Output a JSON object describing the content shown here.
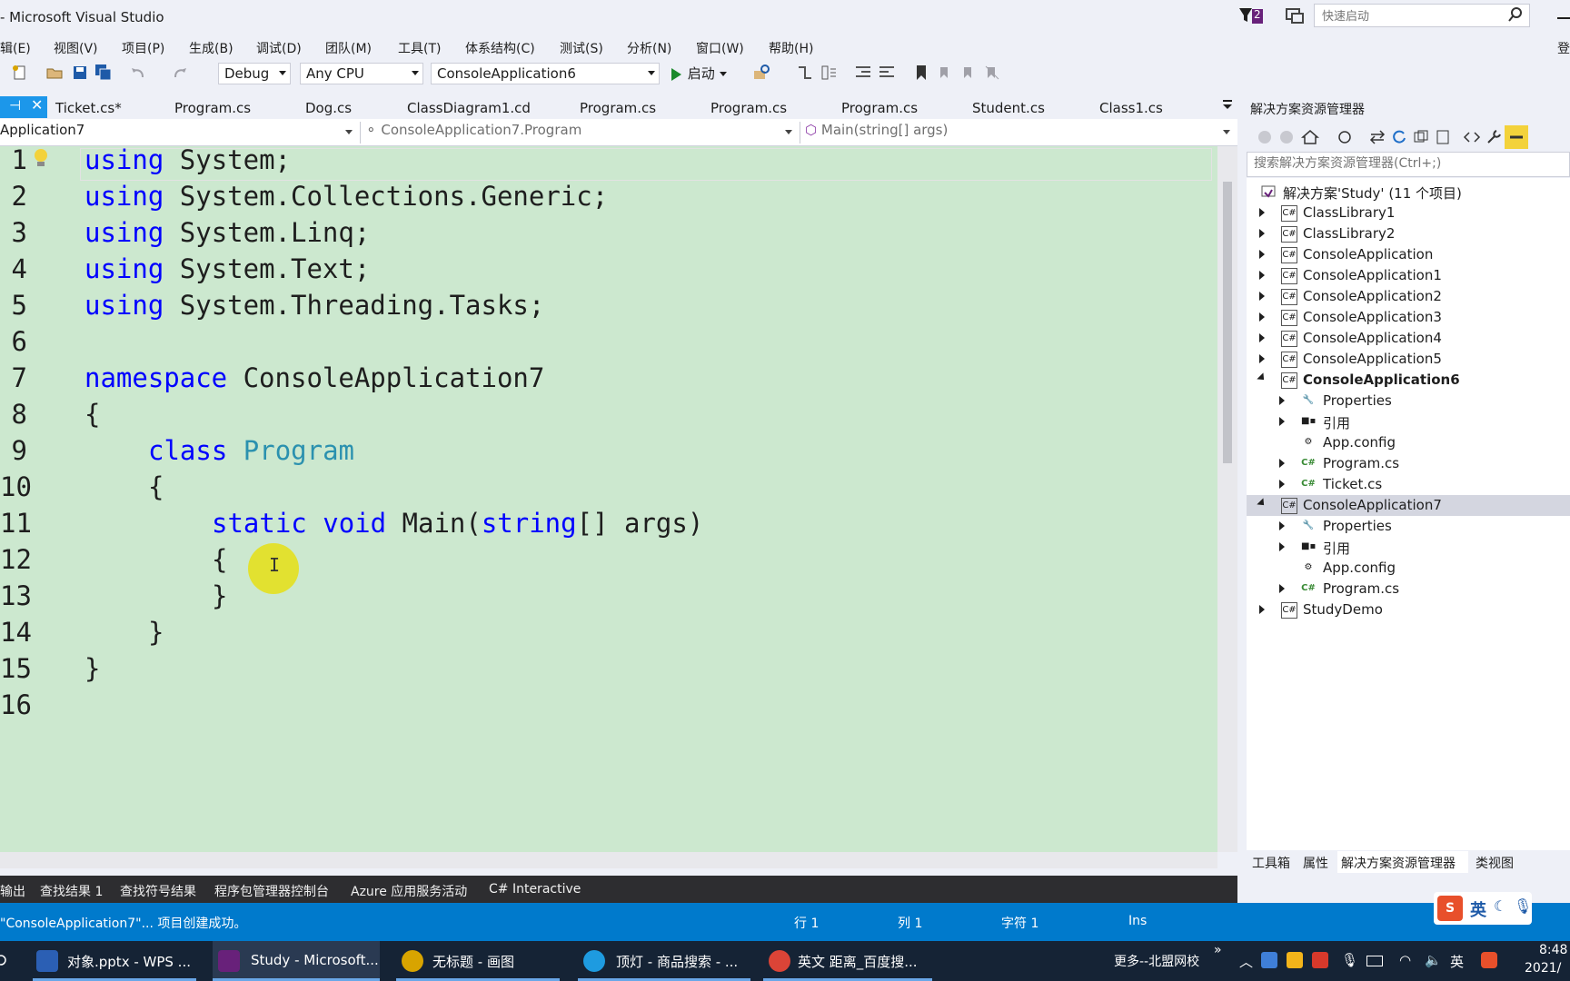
{
  "window": {
    "title": "- Microsoft Visual Studio",
    "notification_count": "2",
    "quick_launch_placeholder": "快速启动",
    "login": "登"
  },
  "menu": [
    "辑(E)",
    "视图(V)",
    "项目(P)",
    "生成(B)",
    "调试(D)",
    "团队(M)",
    "工具(T)",
    "体系结构(C)",
    "测试(S)",
    "分析(N)",
    "窗口(W)",
    "帮助(H)"
  ],
  "toolbar": {
    "config": "Debug",
    "platform": "Any CPU",
    "startup_project": "ConsoleApplication6",
    "run_label": "启动"
  },
  "tabs": [
    "Ticket.cs*",
    "Program.cs",
    "Dog.cs",
    "ClassDiagram1.cd",
    "Program.cs",
    "Program.cs",
    "Program.cs",
    "Student.cs",
    "Class1.cs"
  ],
  "navbar": {
    "project": "Application7",
    "type": "ConsoleApplication7.Program",
    "member": "Main(string[] args)"
  },
  "code": {
    "line_numbers": [
      "1",
      "2",
      "3",
      "4",
      "5",
      "6",
      "7",
      "8",
      "9",
      "10",
      "11",
      "12",
      "13",
      "14",
      "15",
      "16"
    ],
    "l1_kw": "using",
    "l1_rest": " System;",
    "l2_kw": "using",
    "l2_rest": " System.Collections.Generic;",
    "l3_kw": "using",
    "l3_rest": " System.Linq;",
    "l4_kw": "using",
    "l4_rest": " System.Text;",
    "l5_kw": "using",
    "l5_rest": " System.Threading.Tasks;",
    "l7_kw": "namespace",
    "l7_rest": " ConsoleApplication7",
    "l8": "{",
    "l9_kw": "class",
    "l9_ty": "Program",
    "l10": "{",
    "l11_kw1": "static",
    "l11_kw2": "void",
    "l11_mid": " Main(",
    "l11_kw3": "string",
    "l11_rest": "[] args)",
    "l12": "{",
    "l13": "}",
    "l14": "}",
    "l15": "}",
    "cursor_glyph": "I"
  },
  "solution_explorer": {
    "title": "解决方案资源管理器",
    "search_placeholder": "搜索解决方案资源管理器(Ctrl+;)",
    "items": [
      {
        "label": "解决方案'Study' (11 个项目)"
      },
      {
        "label": "ClassLibrary1"
      },
      {
        "label": "ClassLibrary2"
      },
      {
        "label": "ConsoleApplication"
      },
      {
        "label": "ConsoleApplication1"
      },
      {
        "label": "ConsoleApplication2"
      },
      {
        "label": "ConsoleApplication3"
      },
      {
        "label": "ConsoleApplication4"
      },
      {
        "label": "ConsoleApplication5"
      },
      {
        "label": "ConsoleApplication6"
      },
      {
        "label": "Properties"
      },
      {
        "label": "引用"
      },
      {
        "label": "App.config"
      },
      {
        "label": "Program.cs"
      },
      {
        "label": "Ticket.cs"
      },
      {
        "label": "ConsoleApplication7"
      },
      {
        "label": "Properties"
      },
      {
        "label": "引用"
      },
      {
        "label": "App.config"
      },
      {
        "label": "Program.cs"
      },
      {
        "label": "StudyDemo"
      }
    ],
    "bottom_tabs": [
      "工具箱",
      "属性",
      "解决方案资源管理器",
      "类视图"
    ]
  },
  "bottom_panel_tabs": [
    "输出",
    "查找结果 1",
    "查找符号结果",
    "程序包管理器控制台",
    "Azure 应用服务活动",
    "C# Interactive"
  ],
  "status": {
    "message": "\"ConsoleApplication7\"... 项目创建成功。",
    "row": "行 1",
    "col": "列 1",
    "char": "字符 1",
    "mode": "Ins"
  },
  "ime": {
    "label": "英"
  },
  "taskbar": {
    "apps": [
      "对象.pptx - WPS ...",
      "Study - Microsoft...",
      "无标题 - 画图",
      "顶灯 - 商品搜索 - ...",
      "英文 距离_百度搜..."
    ],
    "tray_text": "更多--北盟网校",
    "tray_lang": "英",
    "time": "8:48",
    "date": "2021/"
  },
  "colors": {
    "accent": "#007acc",
    "editor_bg": "#cce8cf",
    "keyword": "#0000ff",
    "type": "#2b91af"
  }
}
